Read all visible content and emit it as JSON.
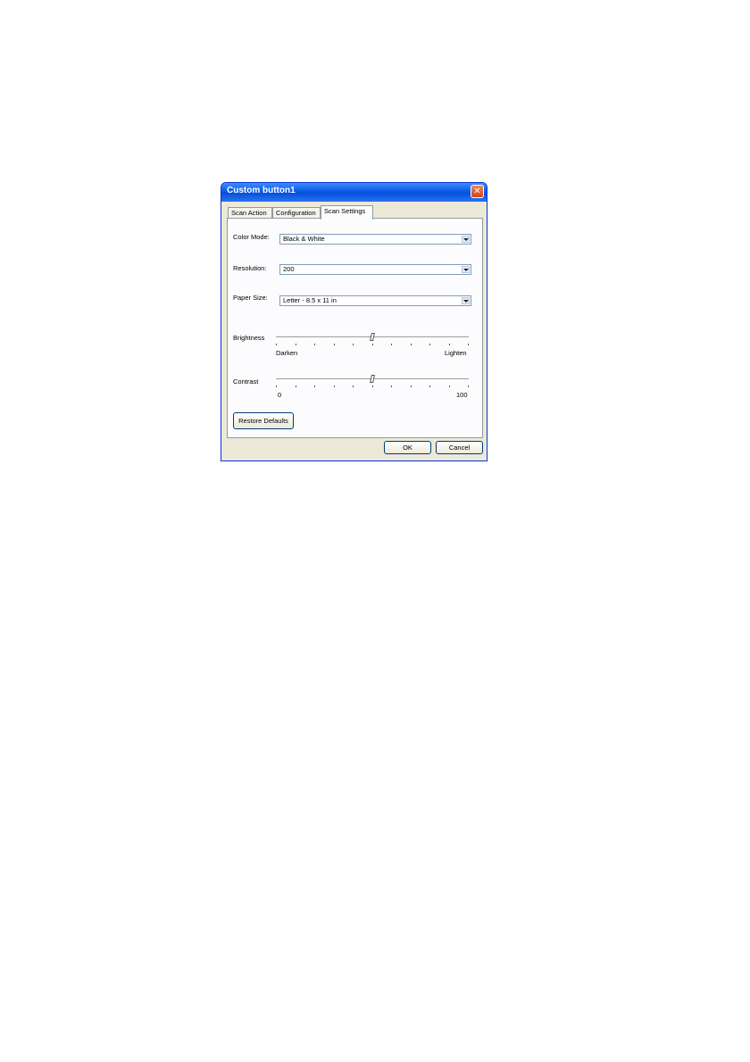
{
  "window": {
    "title": "Custom button1"
  },
  "tabs": [
    {
      "label": "Scan Action"
    },
    {
      "label": "Configuration"
    },
    {
      "label": "Scan Settings"
    }
  ],
  "active_tab": "Scan Settings",
  "fields": {
    "color_mode": {
      "label": "Color Mode:",
      "value": "Black & White"
    },
    "resolution": {
      "label": "Resolution:",
      "value": "200"
    },
    "paper_size": {
      "label": "Paper Size:",
      "value": "Letter - 8.5 x 11 in"
    }
  },
  "brightness": {
    "label": "Brightness",
    "min_label": "Darken",
    "max_label": "Lighten",
    "value": 50,
    "min": 0,
    "max": 100
  },
  "contrast": {
    "label": "Contrast",
    "min_label": "0",
    "max_label": "100",
    "value": 50,
    "min": 0,
    "max": 100
  },
  "buttons": {
    "restore_defaults": "Restore Defaults",
    "ok": "OK",
    "cancel": "Cancel"
  },
  "icons": {
    "close": "close-icon",
    "dropdown": "chevron-down-icon"
  }
}
